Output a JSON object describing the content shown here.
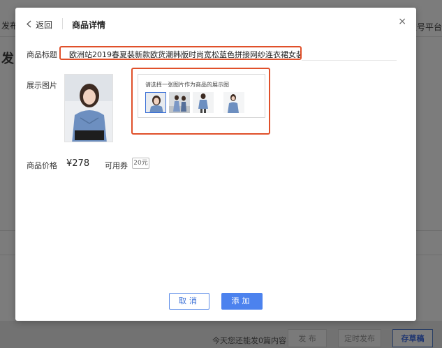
{
  "background": {
    "top_left_text": "发布",
    "top_right_text": "百家号平台",
    "heading": "发",
    "footer": {
      "notice": "今天您还能发0篇内容",
      "publish_label": "发 布",
      "schedule_label": "定时发布",
      "draft_label": "存草稿"
    }
  },
  "modal": {
    "back_label": "返回",
    "title": "商品详情",
    "close_glyph": "×",
    "product_title_label": "商品标题",
    "product_title_value": "欧洲站2019春夏装新款欧货潮韩版时尚宽松蓝色拼接网纱连衣裙女装",
    "display_image_label": "展示图片",
    "chooser_tip": "请选择一张图片作为商品的展示图",
    "thumbnails": [
      {
        "selected": true
      },
      {
        "selected": false
      },
      {
        "selected": false
      },
      {
        "selected": false
      }
    ],
    "price_label": "商品价格",
    "price_value": "¥278",
    "coupon_label": "可用券",
    "coupon_value": "20元",
    "cancel_label": "取消",
    "add_label": "添加"
  },
  "colors": {
    "accent": "#4c82ee",
    "highlight": "#e0502a"
  }
}
